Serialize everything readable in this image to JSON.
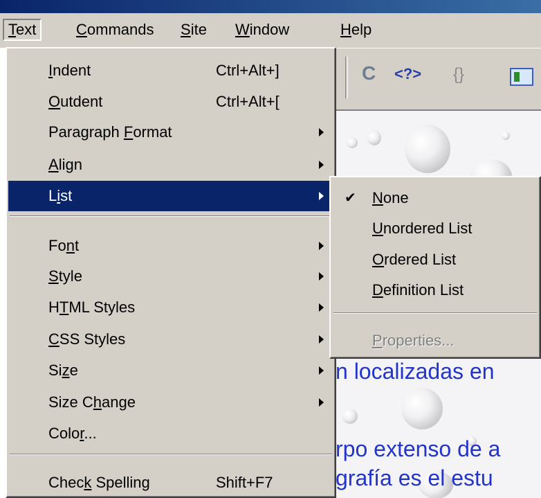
{
  "menubar": {
    "items": [
      {
        "label": "Text",
        "ul": "T",
        "rest": "ext"
      },
      {
        "label": "Commands",
        "ul": "C",
        "rest": "ommands"
      },
      {
        "label": "Site",
        "ul": "S",
        "rest": "ite"
      },
      {
        "label": "Window",
        "ul": "W",
        "rest": "indow"
      },
      {
        "label": "Help",
        "ul": "H",
        "rest": "elp"
      }
    ]
  },
  "toolbar": {
    "refresh_icon": "refresh-icon",
    "code_label": "<?>",
    "braces_label": "{}",
    "view_icon": "design-view-icon"
  },
  "text_menu": {
    "items": [
      {
        "pre": "",
        "ul": "I",
        "post": "ndent",
        "shortcut": "Ctrl+Alt+]",
        "submenu": false
      },
      {
        "pre": "",
        "ul": "O",
        "post": "utdent",
        "shortcut": "Ctrl+Alt+[",
        "submenu": false
      },
      {
        "pre": "Paragraph ",
        "ul": "F",
        "post": "ormat",
        "shortcut": "",
        "submenu": true
      },
      {
        "pre": "",
        "ul": "A",
        "post": "lign",
        "shortcut": "",
        "submenu": true
      },
      {
        "pre": "L",
        "ul": "i",
        "post": "st",
        "shortcut": "",
        "submenu": true,
        "highlighted": true
      },
      {
        "pre": "Fo",
        "ul": "n",
        "post": "t",
        "shortcut": "",
        "submenu": true
      },
      {
        "pre": "",
        "ul": "S",
        "post": "tyle",
        "shortcut": "",
        "submenu": true
      },
      {
        "pre": "H",
        "ul": "T",
        "post": "ML Styles",
        "shortcut": "",
        "submenu": true
      },
      {
        "pre": "",
        "ul": "C",
        "post": "SS Styles",
        "shortcut": "",
        "submenu": true
      },
      {
        "pre": "Si",
        "ul": "z",
        "post": "e",
        "shortcut": "",
        "submenu": true
      },
      {
        "pre": "Size C",
        "ul": "h",
        "post": "ange",
        "shortcut": "",
        "submenu": true
      },
      {
        "pre": "Colo",
        "ul": "r",
        "post": "...",
        "shortcut": "",
        "submenu": false
      },
      {
        "pre": "Chec",
        "ul": "k",
        "post": " Spelling",
        "shortcut": "Shift+F7",
        "submenu": false
      }
    ]
  },
  "list_submenu": {
    "items": [
      {
        "pre": "",
        "ul": "N",
        "post": "one",
        "checked": true,
        "disabled": false
      },
      {
        "pre": "",
        "ul": "U",
        "post": "nordered List",
        "checked": false,
        "disabled": false
      },
      {
        "pre": "",
        "ul": "O",
        "post": "rdered List",
        "checked": false,
        "disabled": false
      },
      {
        "pre": "",
        "ul": "D",
        "post": "efinition List",
        "checked": false,
        "disabled": false
      },
      {
        "pre": "",
        "ul": "P",
        "post": "roperties...",
        "checked": false,
        "disabled": true
      }
    ],
    "check_glyph": "✔"
  },
  "document": {
    "line1": "n localizadas en",
    "line2": "rpo extenso de a",
    "line3": "grafía es el estu"
  },
  "colors": {
    "menu_bg": "#d4d0c8",
    "highlight": "#0a246a",
    "doc_text": "#2334c8"
  }
}
